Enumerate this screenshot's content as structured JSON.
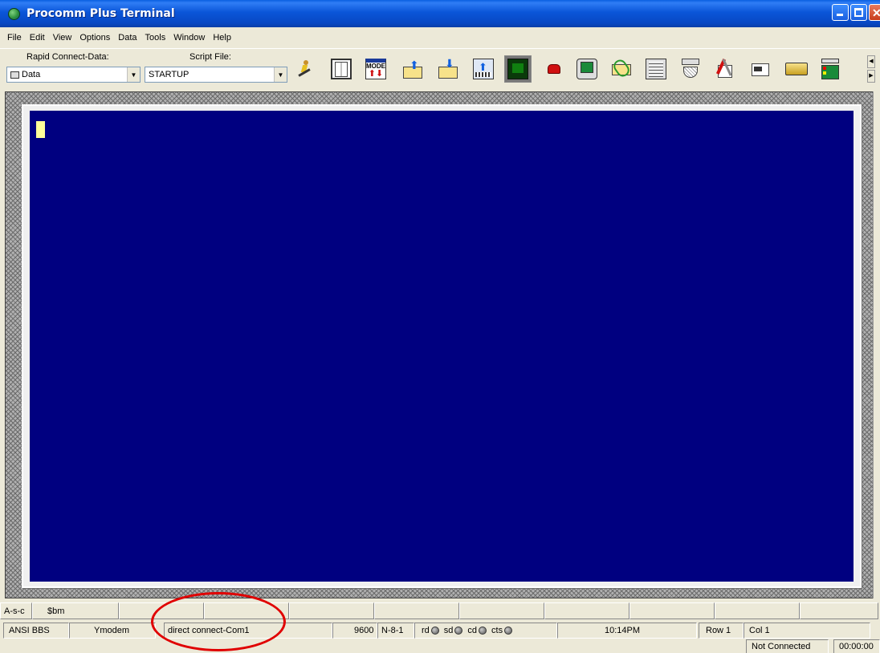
{
  "window": {
    "title": "Procomm Plus Terminal"
  },
  "menu": [
    "File",
    "Edit",
    "View",
    "Options",
    "Data",
    "Tools",
    "Window",
    "Help"
  ],
  "toolbar": {
    "rapid_connect_label": "Rapid Connect-Data:",
    "rapid_connect_value": "Data",
    "script_file_label": "Script File:",
    "script_file_value": "STARTUP",
    "buttons": [
      "runner-icon",
      "phonebook-icon",
      "mode-icon",
      "send-file-icon",
      "receive-file-icon",
      "upload-icon",
      "terminal-icon",
      "phone-icon",
      "monitor-icon",
      "attach-icon",
      "print-icon",
      "capture-icon",
      "setup-icon",
      "script-icon",
      "tape-icon",
      "modem-icon"
    ],
    "mode_text": "MODE"
  },
  "meta_keys": {
    "key1": "A-s-c",
    "key2": "$bm"
  },
  "status": {
    "emulation": "ANSI BBS",
    "protocol": "Ymodem",
    "connection": "direct connect-Com1",
    "baud": "9600",
    "parity": "N-8-1",
    "rd": "rd",
    "sd": "sd",
    "cd": "cd",
    "cts": "cts",
    "time": "10:14PM",
    "row": "Row 1",
    "col": "Col 1",
    "connection_state": "Not Connected",
    "elapsed": "00:00:00"
  },
  "colors": {
    "terminal_bg": "#000080",
    "cursor": "#ffff99",
    "annotation": "#e00000"
  }
}
